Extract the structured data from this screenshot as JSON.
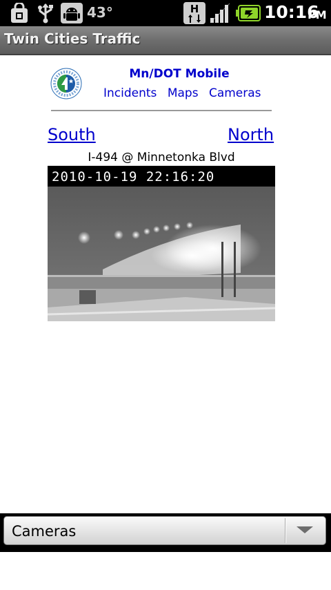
{
  "status_bar": {
    "temperature": "43°",
    "time": "10:16",
    "ampm": "PM",
    "icons": [
      "shopping-bag-icon",
      "usb-icon",
      "android-debug-icon",
      "hspa-data-icon",
      "signal-strength-icon",
      "battery-charging-icon"
    ]
  },
  "app": {
    "title": "Twin Cities Traffic"
  },
  "site": {
    "title": "Mn/DOT Mobile",
    "nav": [
      "Incidents",
      "Maps",
      "Cameras"
    ]
  },
  "camera": {
    "prev_label": "South",
    "next_label": "North",
    "location": "I-494 @ Minnetonka Blvd",
    "timestamp": "2010-10-19 22:16:20"
  },
  "bottom_spinner": {
    "selected": "Cameras"
  },
  "colors": {
    "link": "#0000cc",
    "title_bar": "#6e6e6e",
    "status_bar": "#000000"
  }
}
